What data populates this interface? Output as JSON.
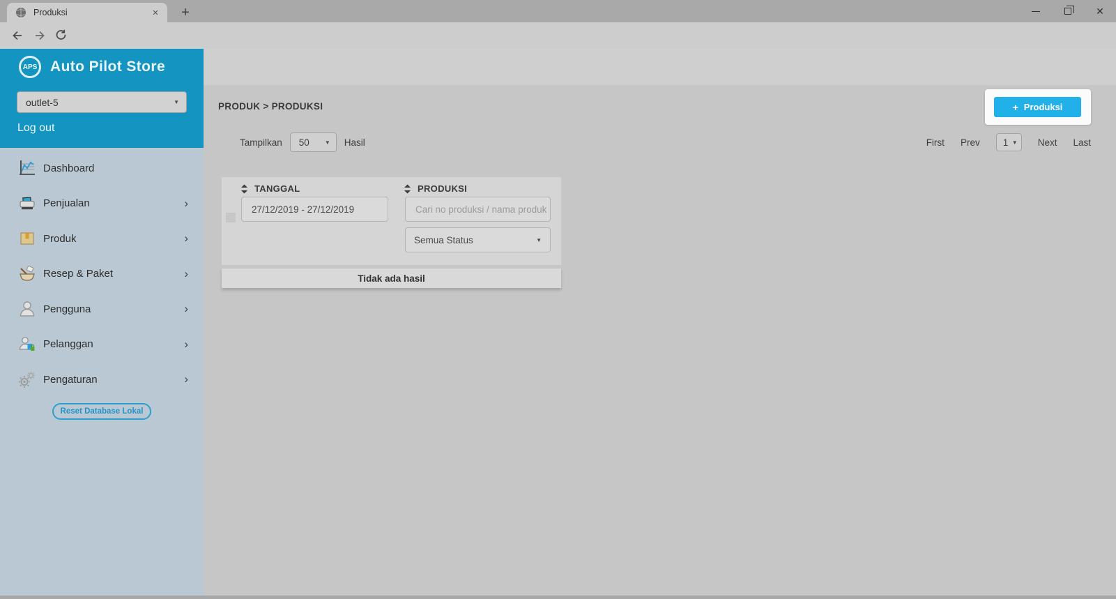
{
  "browser": {
    "tab_title": "Produksi",
    "url_host": "member.autopilotstore.co.id",
    "url_path": "/produksi.php"
  },
  "icons": {
    "tab_close": "×",
    "new_tab": "+",
    "window_close": "✕",
    "bookmark_star": "☆",
    "menu_dots": "⋮",
    "dropdown_caret": "▼",
    "chevron_right": "›",
    "add_plus": "+"
  },
  "sidebar": {
    "logo_text": "APS",
    "brand": "Auto Pilot Store",
    "outlet_value": "outlet-5",
    "logout_label": "Log out",
    "items": [
      {
        "label": "Dashboard",
        "icon": "chart-icon"
      },
      {
        "label": "Penjualan",
        "icon": "cash-register-icon"
      },
      {
        "label": "Produk",
        "icon": "package-icon"
      },
      {
        "label": "Resep & Paket",
        "icon": "mortar-icon"
      },
      {
        "label": "Pengguna",
        "icon": "user-icon"
      },
      {
        "label": "Pelanggan",
        "icon": "customer-icon"
      },
      {
        "label": "Pengaturan",
        "icon": "gears-icon"
      }
    ],
    "reset_button_label": "Reset Database Lokal"
  },
  "main": {
    "breadcrumb": "PRODUK > PRODUKSI",
    "results": {
      "label": "Tampilkan",
      "value": "50",
      "suffix": "Hasil"
    },
    "add_button_label": "Produksi",
    "pagination": {
      "first": "First",
      "prev": "Prev",
      "page": "1",
      "next": "Next",
      "last": "Last"
    },
    "filters": {
      "date_column": "TANGGAL",
      "produksi_column": "PRODUKSI",
      "date_value": "27/12/2019 - 27/12/2019",
      "search_placeholder": "Cari no produksi / nama produk",
      "status_value": "Semua Status"
    },
    "empty_message": "Tidak ada hasil"
  },
  "colors": {
    "teal_header": "#1495c1",
    "sidebar_bg": "#b9c8d2",
    "accent_blue": "#22b0e8",
    "page_bg": "#c6c6c6",
    "highlight_white": "#fbfbfb"
  }
}
